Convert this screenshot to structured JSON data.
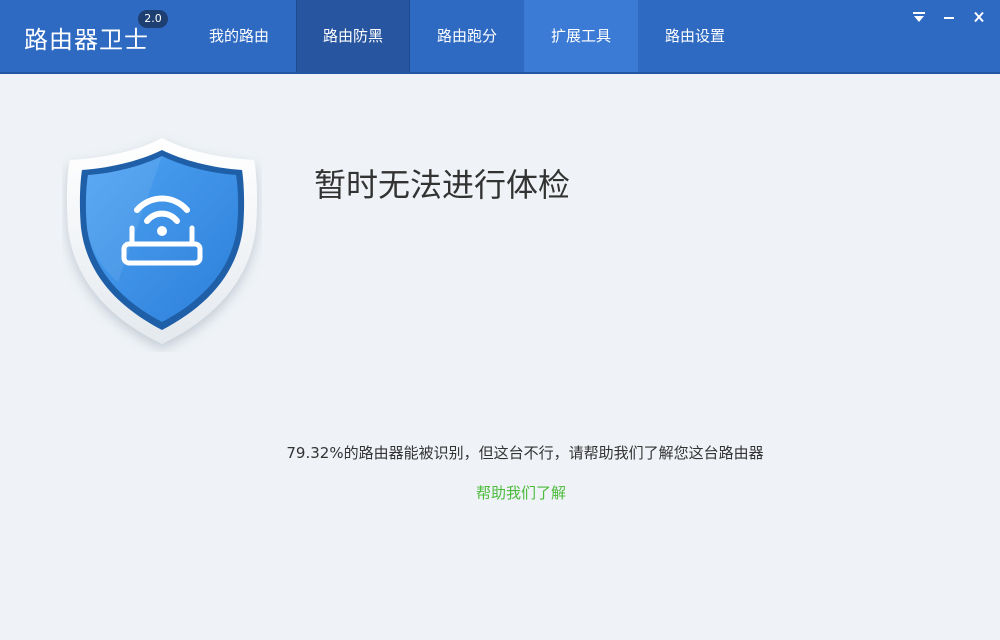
{
  "header": {
    "app_title": "路由器卫士",
    "version": "2.0",
    "tabs": [
      {
        "label": "我的路由"
      },
      {
        "label": "路由防黑"
      },
      {
        "label": "路由跑分"
      },
      {
        "label": "扩展工具"
      },
      {
        "label": "路由设置"
      }
    ],
    "active_tab": "路由防黑",
    "hover_tab": "扩展工具"
  },
  "window_controls": {
    "icons": [
      "dropdown-menu-icon",
      "minimize-icon",
      "close-icon"
    ]
  },
  "main": {
    "shield_icon": "router-shield-icon",
    "headline": "暂时无法进行体检",
    "info_text": "79.32%的路由器能被识别，但这台不行，请帮助我们了解您这台路由器",
    "help_link": "帮助我们了解"
  },
  "colors": {
    "titlebar": "#2e69c2",
    "active_tab": "#2755a0",
    "hover_tab": "#3b7bd5",
    "background": "#eff3f7",
    "link": "#4cbb3c"
  }
}
